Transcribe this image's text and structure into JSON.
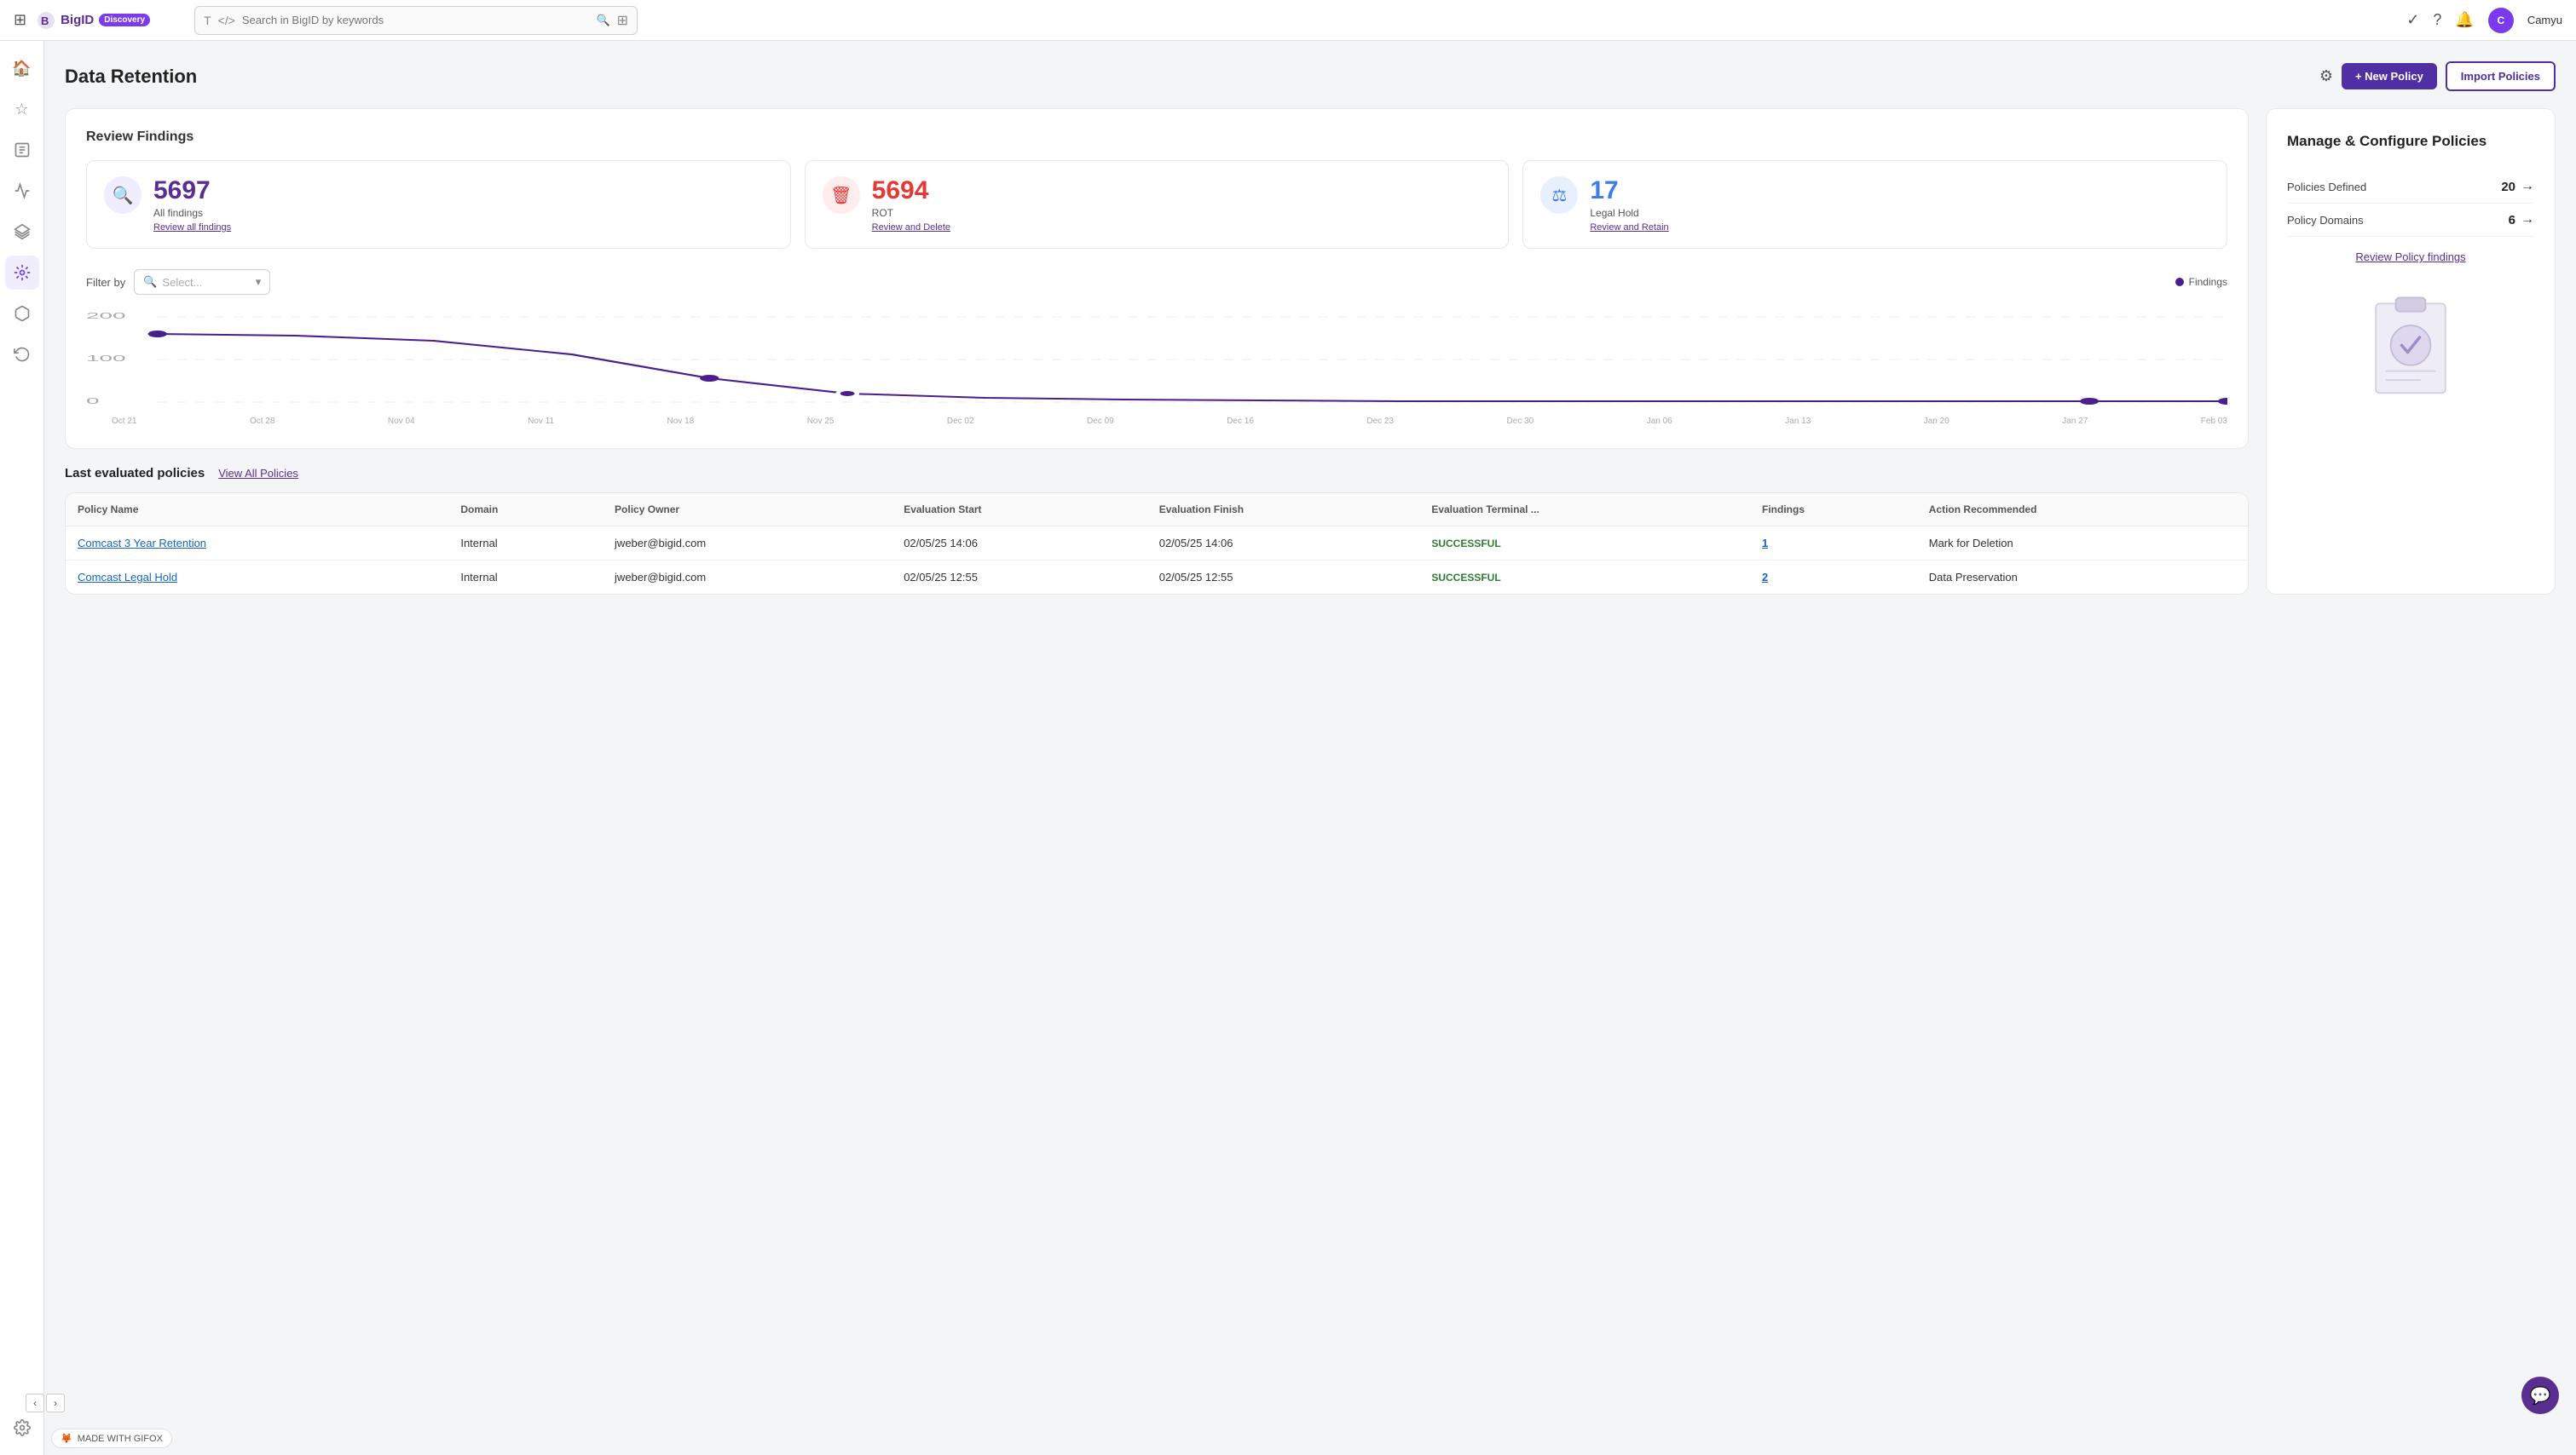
{
  "topnav": {
    "grid_icon": "⊞",
    "logo_text": "BigID",
    "logo_sub": "Discovery",
    "search_placeholder": "Search in BigID by keywords",
    "username": "Camyu"
  },
  "sidebar": {
    "items": [
      {
        "id": "home",
        "icon": "🏠",
        "active": false
      },
      {
        "id": "star",
        "icon": "☆",
        "active": false
      },
      {
        "id": "chart",
        "icon": "📊",
        "active": false
      },
      {
        "id": "activity",
        "icon": "⚡",
        "active": false
      },
      {
        "id": "layers",
        "icon": "☰",
        "active": false
      },
      {
        "id": "data",
        "icon": "🔷",
        "active": true
      },
      {
        "id": "cube",
        "icon": "⬡",
        "active": false
      },
      {
        "id": "refresh",
        "icon": "↺",
        "active": false
      },
      {
        "id": "gear",
        "icon": "⚙",
        "active": false
      },
      {
        "id": "edit",
        "icon": "✎",
        "active": false
      }
    ]
  },
  "page": {
    "title": "Data Retention",
    "settings_icon": "⚙",
    "new_policy_label": "+ New Policy",
    "import_policy_label": "Import Policies"
  },
  "review_findings": {
    "section_title": "Review Findings",
    "cards": [
      {
        "id": "all-findings",
        "count": "5697",
        "label": "All findings",
        "link": "Review all findings",
        "icon": "🔍",
        "icon_style": "purple",
        "count_style": "purple"
      },
      {
        "id": "rot",
        "count": "5694",
        "label": "ROT",
        "link": "Review and Delete",
        "icon": "🗑",
        "icon_style": "red",
        "count_style": "red"
      },
      {
        "id": "legal-hold",
        "count": "17",
        "label": "Legal Hold",
        "link": "Review and Retain",
        "icon": "⚖",
        "icon_style": "blue",
        "count_style": "blue"
      }
    ],
    "filter": {
      "label": "Filter by",
      "placeholder": "Select..."
    },
    "legend": {
      "label": "Findings",
      "color": "#4a1e8e"
    },
    "chart": {
      "x_labels": [
        "Oct 21",
        "Oct 28",
        "Nov 04",
        "Nov 11",
        "Nov 18",
        "Nov 25",
        "Dec 02",
        "Dec 09",
        "Dec 16",
        "Dec 23",
        "Dec 30",
        "Jan 06",
        "Jan 13",
        "Jan 20",
        "Jan 27",
        "Feb 03"
      ],
      "y_labels": [
        "200",
        "100",
        "0"
      ],
      "data_points": [
        160,
        155,
        145,
        110,
        55,
        20,
        15,
        12,
        10,
        8,
        8,
        8,
        8,
        8,
        8,
        8
      ]
    }
  },
  "manage_panel": {
    "title": "Manage & Configure Policies",
    "rows": [
      {
        "label": "Policies Defined",
        "value": "20"
      },
      {
        "label": "Policy Domains",
        "value": "6"
      }
    ],
    "review_link": "Review Policy findings"
  },
  "last_evaluated": {
    "section_title": "Last evaluated policies",
    "view_all_label": "View All Policies",
    "table": {
      "headers": [
        "Policy Name",
        "Domain",
        "Policy Owner",
        "Evaluation Start",
        "Evaluation Finish",
        "Evaluation Terminal ...",
        "Findings",
        "Action Recommended"
      ],
      "rows": [
        {
          "policy_name": "Comcast 3 Year Retention",
          "domain": "Internal",
          "owner": "jweber@bigid.com",
          "eval_start": "02/05/25 14:06",
          "eval_finish": "02/05/25 14:06",
          "terminal": "SUCCESSFUL",
          "findings": "1",
          "action": "Mark for Deletion"
        },
        {
          "policy_name": "Comcast Legal Hold",
          "domain": "Internal",
          "owner": "jweber@bigid.com",
          "eval_start": "02/05/25 12:55",
          "eval_finish": "02/05/25 12:55",
          "terminal": "SUCCESSFUL",
          "findings": "2",
          "action": "Data Preservation"
        }
      ]
    }
  },
  "gifox": {
    "label": "MADE WITH GIFOX"
  }
}
